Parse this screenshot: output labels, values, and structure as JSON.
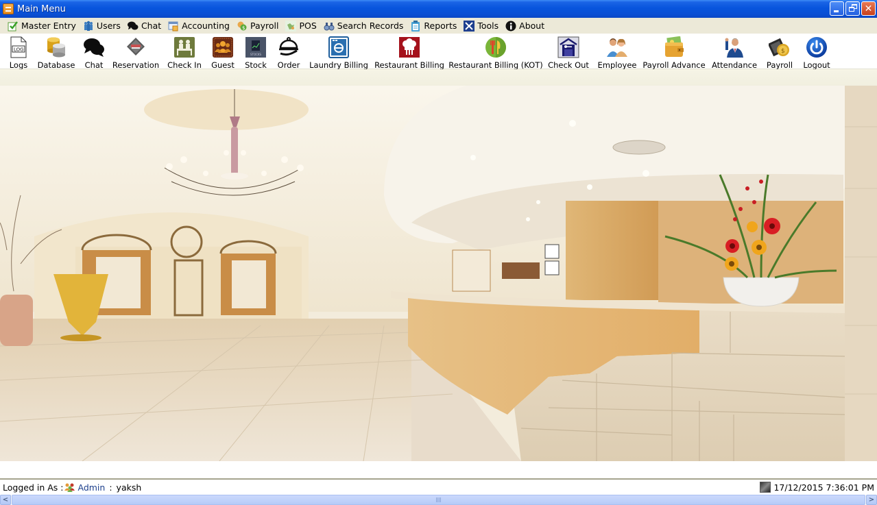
{
  "window": {
    "title": "Main Menu",
    "controls": [
      "minimize",
      "maximize",
      "close"
    ]
  },
  "menubar": {
    "items": [
      {
        "label": "Master Entry",
        "icon": "master-entry-icon"
      },
      {
        "label": "Users",
        "icon": "users-icon"
      },
      {
        "label": "Chat",
        "icon": "chat-icon"
      },
      {
        "label": "Accounting",
        "icon": "accounting-icon"
      },
      {
        "label": "Payroll",
        "icon": "payroll-icon"
      },
      {
        "label": "POS",
        "icon": "pos-icon"
      },
      {
        "label": "Search Records",
        "icon": "binoculars-icon"
      },
      {
        "label": "Reports",
        "icon": "clipboard-icon"
      },
      {
        "label": "Tools",
        "icon": "tools-icon"
      },
      {
        "label": "About",
        "icon": "info-icon"
      }
    ]
  },
  "toolbar": {
    "items": [
      {
        "label": "Logs",
        "icon": "log-file-icon"
      },
      {
        "label": "Database",
        "icon": "database-icon"
      },
      {
        "label": "Chat",
        "icon": "chat-bubbles-icon"
      },
      {
        "label": "Reservation",
        "icon": "reservation-icon"
      },
      {
        "label": "Check In",
        "icon": "check-in-icon"
      },
      {
        "label": "Guest",
        "icon": "guest-icon"
      },
      {
        "label": "Stock",
        "icon": "stock-icon"
      },
      {
        "label": "Order",
        "icon": "cloche-icon"
      },
      {
        "label": "Laundry Billing",
        "icon": "washing-machine-icon"
      },
      {
        "label": "Restaurant Billing",
        "icon": "chef-hat-icon"
      },
      {
        "label": "Restaurant Billing (KOT)",
        "icon": "cutlery-icon"
      },
      {
        "label": "Check Out",
        "icon": "check-out-icon"
      },
      {
        "label": "Employee",
        "icon": "employee-icon"
      },
      {
        "label": "Payroll Advance",
        "icon": "wallet-icon"
      },
      {
        "label": "Attendance",
        "icon": "attendance-icon"
      },
      {
        "label": "Payroll",
        "icon": "money-icon"
      },
      {
        "label": "Logout",
        "icon": "power-icon"
      }
    ]
  },
  "status": {
    "logged_in_label": "Logged in As :",
    "role": "Admin",
    "separator": ":",
    "username": "yaksh",
    "datetime": "17/12/2015 7:36:01 PM"
  },
  "colors": {
    "titlebar": "#0855dd",
    "menubar": "#ece9d8",
    "toolbar": "#ffffff",
    "scrollbar": "#b6cbf8"
  }
}
